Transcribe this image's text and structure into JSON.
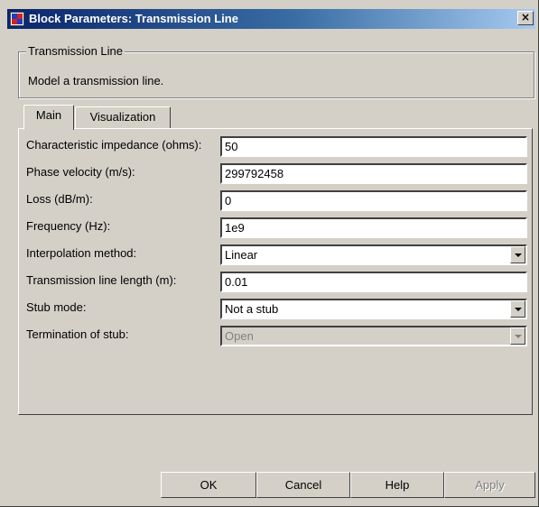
{
  "window": {
    "title": "Block Parameters: Transmission Line",
    "close_symbol": "×"
  },
  "group": {
    "legend": "Transmission Line",
    "description": "Model a transmission line."
  },
  "tabs": [
    {
      "label": "Main",
      "active": true
    },
    {
      "label": "Visualization",
      "active": false
    }
  ],
  "params": [
    {
      "label": "Characteristic impedance (ohms):",
      "value": "50",
      "type": "text"
    },
    {
      "label": "Phase velocity (m/s):",
      "value": "299792458",
      "type": "text"
    },
    {
      "label": "Loss (dB/m):",
      "value": "0",
      "type": "text"
    },
    {
      "label": "Frequency (Hz):",
      "value": "1e9",
      "type": "text"
    },
    {
      "label": "Interpolation method:",
      "value": "Linear",
      "type": "dropdown"
    },
    {
      "label": "Transmission line length (m):",
      "value": "0.01",
      "type": "text"
    },
    {
      "label": "Stub mode:",
      "value": "Not a stub",
      "type": "dropdown"
    },
    {
      "label": "Termination of stub:",
      "value": "Open",
      "type": "dropdown",
      "disabled": true
    }
  ],
  "buttons": {
    "ok": "OK",
    "cancel": "Cancel",
    "help": "Help",
    "apply": "Apply"
  }
}
